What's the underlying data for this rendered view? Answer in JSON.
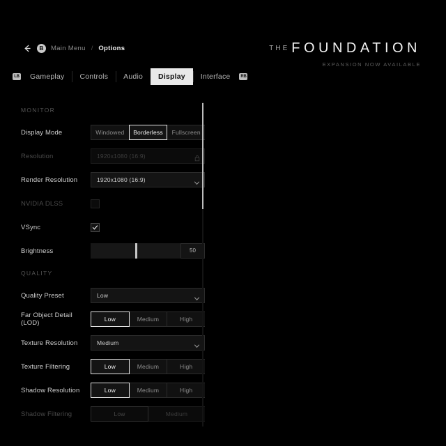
{
  "breadcrumb": {
    "back_icon": "back-arrow-icon",
    "button_glyph": "B",
    "parent": "Main Menu",
    "separator": "/",
    "current": "Options"
  },
  "tabs": {
    "left_bumper": "LB",
    "right_bumper": "RB",
    "items": [
      {
        "label": "Gameplay",
        "active": false
      },
      {
        "label": "Controls",
        "active": false
      },
      {
        "label": "Audio",
        "active": false
      },
      {
        "label": "Display",
        "active": true
      },
      {
        "label": "Interface",
        "active": false
      }
    ]
  },
  "brand": {
    "prefix": "THE",
    "title": "FOUNDATION",
    "subtitle": "EXPANSION NOW AVAILABLE"
  },
  "settings": {
    "sections": [
      {
        "header": "MONITOR",
        "rows": [
          {
            "label": "Display Mode",
            "type": "segmented",
            "disabled": false,
            "options": [
              "Windowed",
              "Borderless",
              "Fullscreen"
            ],
            "selected": "Borderless"
          },
          {
            "label": "Resolution",
            "type": "dropdown-locked",
            "disabled": true,
            "value": "1920x1080 (16:9)",
            "icon": "lock-icon"
          },
          {
            "label": "Render Resolution",
            "type": "dropdown",
            "disabled": false,
            "value": "1920x1080 (16:9)",
            "icon": "chevron-down-icon"
          },
          {
            "label": "NVIDIA DLSS",
            "type": "checkbox",
            "disabled": true,
            "checked": false
          },
          {
            "label": "VSync",
            "type": "checkbox",
            "disabled": false,
            "checked": true
          },
          {
            "label": "Brightness",
            "type": "slider",
            "disabled": false,
            "value": "50",
            "percent": 50
          }
        ]
      },
      {
        "header": "QUALITY",
        "rows": [
          {
            "label": "Quality Preset",
            "type": "dropdown",
            "disabled": false,
            "value": "Low",
            "icon": "chevron-down-icon"
          },
          {
            "label": "Far Object Detail (LOD)",
            "type": "segmented",
            "disabled": false,
            "options": [
              "Low",
              "Medium",
              "High"
            ],
            "selected": "Low"
          },
          {
            "label": "Texture Resolution",
            "type": "dropdown",
            "disabled": false,
            "value": "Medium",
            "icon": "chevron-down-icon"
          },
          {
            "label": "Texture Filtering",
            "type": "segmented",
            "disabled": false,
            "options": [
              "Low",
              "Medium",
              "High"
            ],
            "selected": "Low"
          },
          {
            "label": "Shadow Resolution",
            "type": "segmented",
            "disabled": false,
            "options": [
              "Low",
              "Medium",
              "High"
            ],
            "selected": "Low"
          },
          {
            "label": "Shadow Filtering",
            "type": "segmented",
            "disabled": true,
            "options": [
              "Low",
              "Medium"
            ],
            "selected": "Low"
          }
        ]
      }
    ]
  },
  "colors": {
    "background": "#000000",
    "accent": "#e9e9e9",
    "text": "#cfcfcf",
    "disabled_text": "#4a4a4a",
    "section_header": "#545454"
  }
}
